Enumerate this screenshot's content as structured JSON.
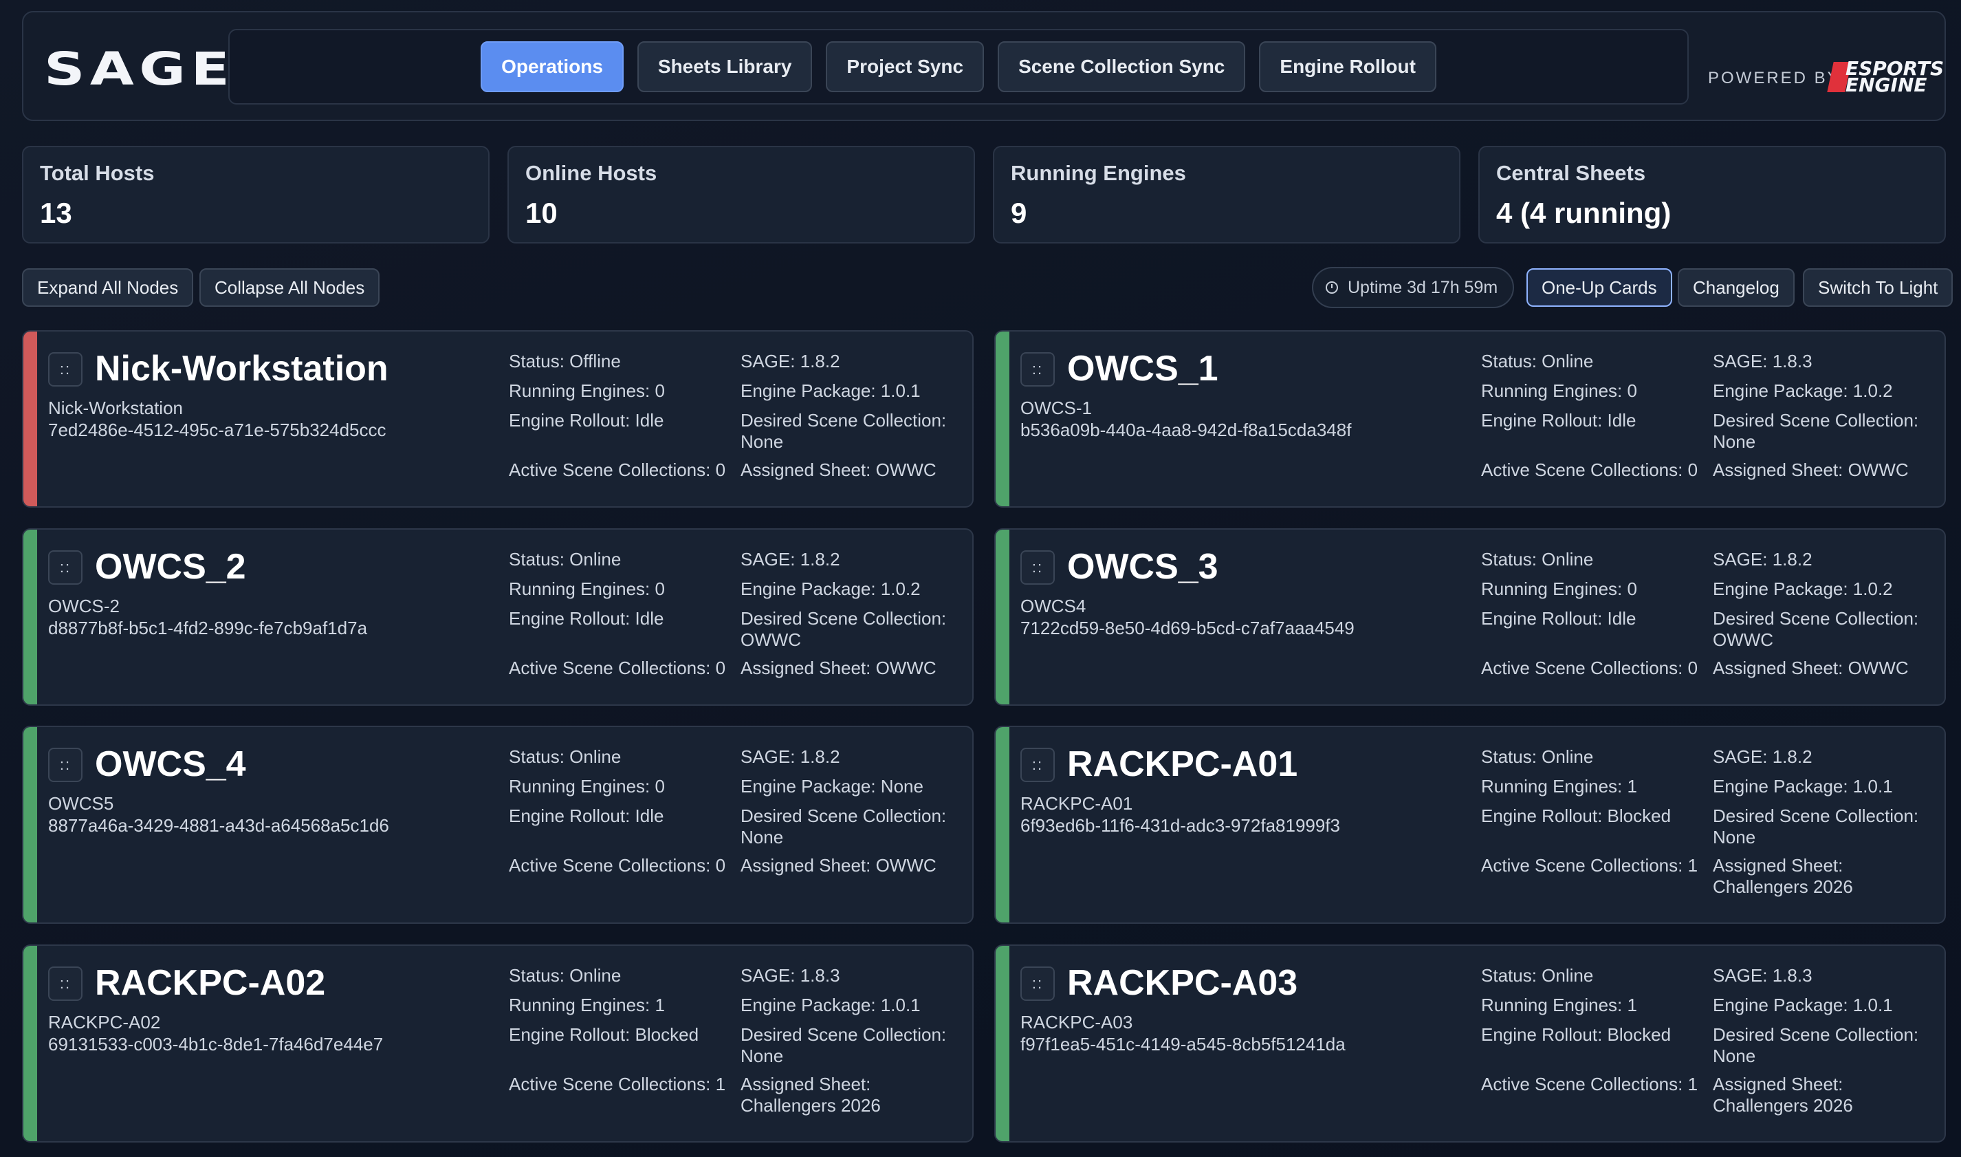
{
  "header": {
    "logo": "SAGE",
    "nav": [
      "Operations",
      "Sheets Library",
      "Project Sync",
      "Scene Collection Sync",
      "Engine Rollout"
    ],
    "active_nav": "Operations",
    "powered_by": "POWERED BY",
    "brand_line1": "ESPORTS",
    "brand_line2": "ENGINE",
    "brand_color": "#e0313b"
  },
  "stats": [
    {
      "label": "Total Hosts",
      "value": "13"
    },
    {
      "label": "Online Hosts",
      "value": "10"
    },
    {
      "label": "Running Engines",
      "value": "9"
    },
    {
      "label": "Central Sheets",
      "value": "4 (4 running)"
    }
  ],
  "toolbar": {
    "expand": "Expand All Nodes",
    "collapse": "Collapse All Nodes",
    "uptime": "Uptime 3d 17h 59m",
    "one_up": "One-Up Cards",
    "changelog": "Changelog",
    "theme": "Switch To Light"
  },
  "colors": {
    "online": "#4fa36a",
    "offline": "#d05a5a",
    "accent": "#5b8df0"
  },
  "hosts": [
    {
      "name": "Nick-Workstation",
      "id": "Nick-Workstation",
      "uuid": "7ed2486e-4512-495c-a71e-575b324d5ccc",
      "status": "Status: Offline",
      "running": "Running Engines: 0",
      "rollout": "Engine Rollout: Idle",
      "active": "Active Scene Collections: 0",
      "sage": "SAGE: 1.8.2",
      "package": "Engine Package: 1.0.1",
      "desired_label": "Desired Scene Collection:",
      "desired_value": "None",
      "sheet_label": "Assigned Sheet: OWWC",
      "sheet_value": "",
      "state": "offline"
    },
    {
      "name": "OWCS_1",
      "id": "OWCS-1",
      "uuid": "b536a09b-440a-4aa8-942d-f8a15cda348f",
      "status": "Status: Online",
      "running": "Running Engines: 0",
      "rollout": "Engine Rollout: Idle",
      "active": "Active Scene Collections: 0",
      "sage": "SAGE: 1.8.3",
      "package": "Engine Package: 1.0.2",
      "desired_label": "Desired Scene Collection:",
      "desired_value": "None",
      "sheet_label": "Assigned Sheet: OWWC",
      "sheet_value": "",
      "state": "online"
    },
    {
      "name": "OWCS_2",
      "id": "OWCS-2",
      "uuid": "d8877b8f-b5c1-4fd2-899c-fe7cb9af1d7a",
      "status": "Status: Online",
      "running": "Running Engines: 0",
      "rollout": "Engine Rollout: Idle",
      "active": "Active Scene Collections: 0",
      "sage": "SAGE: 1.8.2",
      "package": "Engine Package: 1.0.2",
      "desired_label": "Desired Scene Collection:",
      "desired_value": "OWWC",
      "sheet_label": "Assigned Sheet: OWWC",
      "sheet_value": "",
      "state": "online"
    },
    {
      "name": "OWCS_3",
      "id": "OWCS4",
      "uuid": "7122cd59-8e50-4d69-b5cd-c7af7aaa4549",
      "status": "Status: Online",
      "running": "Running Engines: 0",
      "rollout": "Engine Rollout: Idle",
      "active": "Active Scene Collections: 0",
      "sage": "SAGE: 1.8.2",
      "package": "Engine Package: 1.0.2",
      "desired_label": "Desired Scene Collection:",
      "desired_value": "OWWC",
      "sheet_label": "Assigned Sheet: OWWC",
      "sheet_value": "",
      "state": "online"
    },
    {
      "name": "OWCS_4",
      "id": "OWCS5",
      "uuid": "8877a46a-3429-4881-a43d-a64568a5c1d6",
      "status": "Status: Online",
      "running": "Running Engines: 0",
      "rollout": "Engine Rollout: Idle",
      "active": "Active Scene Collections: 0",
      "sage": "SAGE: 1.8.2",
      "package": "Engine Package: None",
      "desired_label": "Desired Scene Collection:",
      "desired_value": "None",
      "sheet_label": "Assigned Sheet: OWWC",
      "sheet_value": "",
      "state": "online"
    },
    {
      "name": "RACKPC-A01",
      "id": "RACKPC-A01",
      "uuid": "6f93ed6b-11f6-431d-adc3-972fa81999f3",
      "status": "Status: Online",
      "running": "Running Engines: 1",
      "rollout": "Engine Rollout: Blocked",
      "active": "Active Scene Collections: 1",
      "sage": "SAGE: 1.8.2",
      "package": "Engine Package: 1.0.1",
      "desired_label": "Desired Scene Collection:",
      "desired_value": "None",
      "sheet_label": "Assigned Sheet:",
      "sheet_value": "Challengers 2026",
      "state": "online"
    },
    {
      "name": "RACKPC-A02",
      "id": "RACKPC-A02",
      "uuid": "69131533-c003-4b1c-8de1-7fa46d7e44e7",
      "status": "Status: Online",
      "running": "Running Engines: 1",
      "rollout": "Engine Rollout: Blocked",
      "active": "Active Scene Collections: 1",
      "sage": "SAGE: 1.8.3",
      "package": "Engine Package: 1.0.1",
      "desired_label": "Desired Scene Collection:",
      "desired_value": "None",
      "sheet_label": "Assigned Sheet:",
      "sheet_value": "Challengers 2026",
      "state": "online"
    },
    {
      "name": "RACKPC-A03",
      "id": "RACKPC-A03",
      "uuid": "f97f1ea5-451c-4149-a545-8cb5f51241da",
      "status": "Status: Online",
      "running": "Running Engines: 1",
      "rollout": "Engine Rollout: Blocked",
      "active": "Active Scene Collections: 1",
      "sage": "SAGE: 1.8.3",
      "package": "Engine Package: 1.0.1",
      "desired_label": "Desired Scene Collection:",
      "desired_value": "None",
      "sheet_label": "Assigned Sheet:",
      "sheet_value": "Challengers 2026",
      "state": "online"
    }
  ]
}
